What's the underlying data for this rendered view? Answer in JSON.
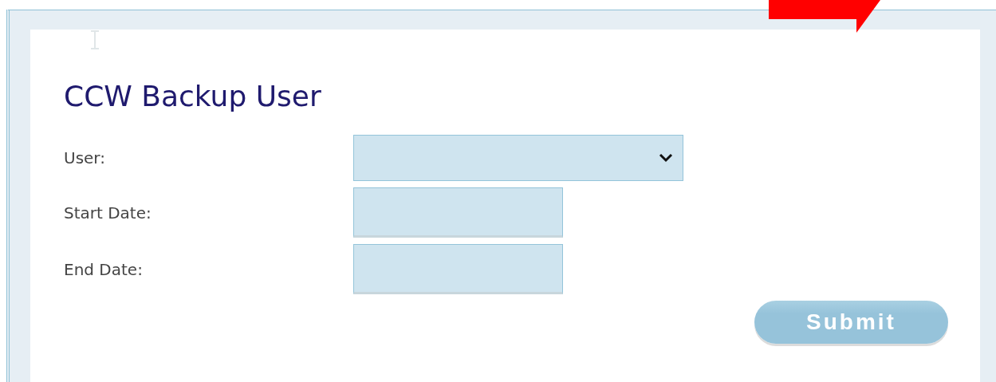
{
  "form": {
    "title": "CCW Backup User",
    "fields": [
      {
        "kind": "select",
        "label": "User:"
      },
      {
        "kind": "date",
        "label": "Start Date:"
      },
      {
        "kind": "date",
        "label": "End Date:"
      }
    ],
    "submit": "Submit"
  }
}
